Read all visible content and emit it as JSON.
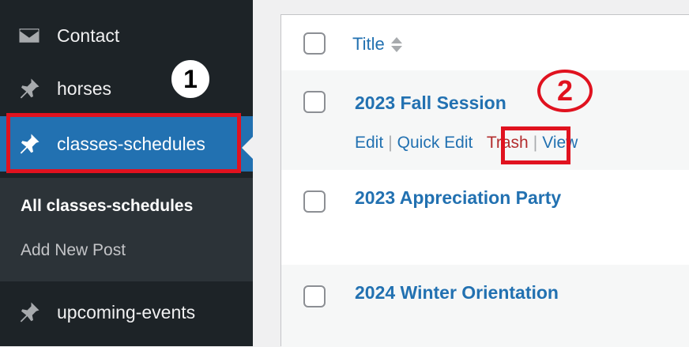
{
  "sidebar": {
    "items": [
      {
        "label": "Contact",
        "icon": "envelope-icon"
      },
      {
        "label": "horses",
        "icon": "pushpin-icon"
      },
      {
        "label": "classes-schedules",
        "icon": "pushpin-icon",
        "active": true
      },
      {
        "label": "upcoming-events",
        "icon": "pushpin-icon"
      }
    ],
    "submenu": {
      "all_label": "All classes-schedules",
      "add_label": "Add New Post"
    }
  },
  "annotations": {
    "step1": "1",
    "step2": "2",
    "color": "#e0121f"
  },
  "table": {
    "header": {
      "title": "Title"
    },
    "rows": [
      {
        "title": "2023 Fall Session"
      },
      {
        "title": "2023 Appreciation Party"
      },
      {
        "title": "2024 Winter Orientation"
      }
    ],
    "row_actions": {
      "edit": "Edit",
      "sep": "|",
      "quick_edit": "Quick Edit",
      "trash": "Trash",
      "view": "View"
    }
  },
  "colors": {
    "sidebar_bg": "#1d2327",
    "active_bg": "#2271b1",
    "link": "#2271b1",
    "trash": "#b32d2e"
  }
}
